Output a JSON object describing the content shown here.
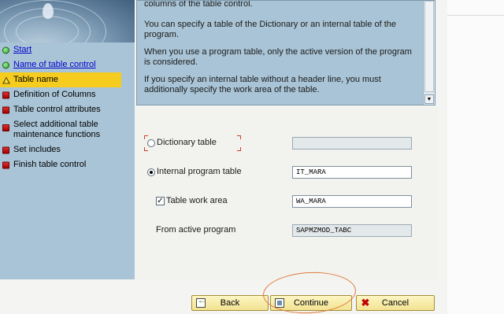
{
  "wizard_steps": [
    {
      "label": "Start",
      "status": "done",
      "link": true
    },
    {
      "label": "Name of table control",
      "status": "done",
      "link": true
    },
    {
      "label": "Table name",
      "status": "current",
      "link": false
    },
    {
      "label": "Definition of Columns",
      "status": "pending",
      "link": false
    },
    {
      "label": "Table control attributes",
      "status": "pending",
      "link": false
    },
    {
      "label": "Select additional table maintenance functions",
      "status": "pending",
      "link": false
    },
    {
      "label": "Set includes",
      "status": "pending",
      "link": false
    },
    {
      "label": "Finish table control",
      "status": "pending",
      "link": false
    }
  ],
  "help": {
    "p1": "columns of the table control.",
    "p2": "You can specify a table of the Dictionary or an internal table of the program.",
    "p3": "When you use a program table, only the active version of the program is considered.",
    "p4": "If you specify an internal table without a header line, you must additionally specify the work area of the table."
  },
  "form": {
    "dictionary_table": {
      "label": "Dictionary table",
      "value": "",
      "selected": false
    },
    "internal_program_table": {
      "label": "Internal program table",
      "value": "IT_MARA",
      "selected": true
    },
    "table_work_area": {
      "label": "Table work area",
      "value": "WA_MARA",
      "checked": true
    },
    "from_active_program": {
      "label": "From active program",
      "value": "SAPMZMOD_TABC"
    }
  },
  "buttons": {
    "back": "Back",
    "continue": "Continue",
    "cancel": "Cancel"
  },
  "colors": {
    "panel_blue": "#a9c4d6",
    "active_step": "#f6cc1e",
    "button_yellow": "#f2e291",
    "annotation": "#e07a3a"
  }
}
